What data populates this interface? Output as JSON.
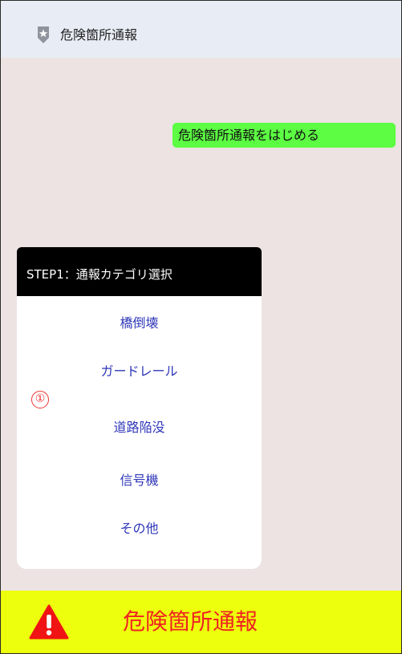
{
  "header": {
    "title": "危険箇所通報",
    "icon": "location-pin-icon"
  },
  "chat": {
    "bubble_text": "危険箇所通報をはじめる",
    "bubble_color": "#5cfd43"
  },
  "card": {
    "title": "STEP1：通報カテゴリ選択",
    "options": [
      "橋倒壊",
      "ガードレール",
      "道路陥没",
      "信号機",
      "その他"
    ],
    "option_color": "#2f37b8"
  },
  "annotation": {
    "marker": "①"
  },
  "footer": {
    "label": "危険箇所通報",
    "icon": "warning-icon",
    "background": "#edff0c",
    "text_color": "#f02222"
  }
}
